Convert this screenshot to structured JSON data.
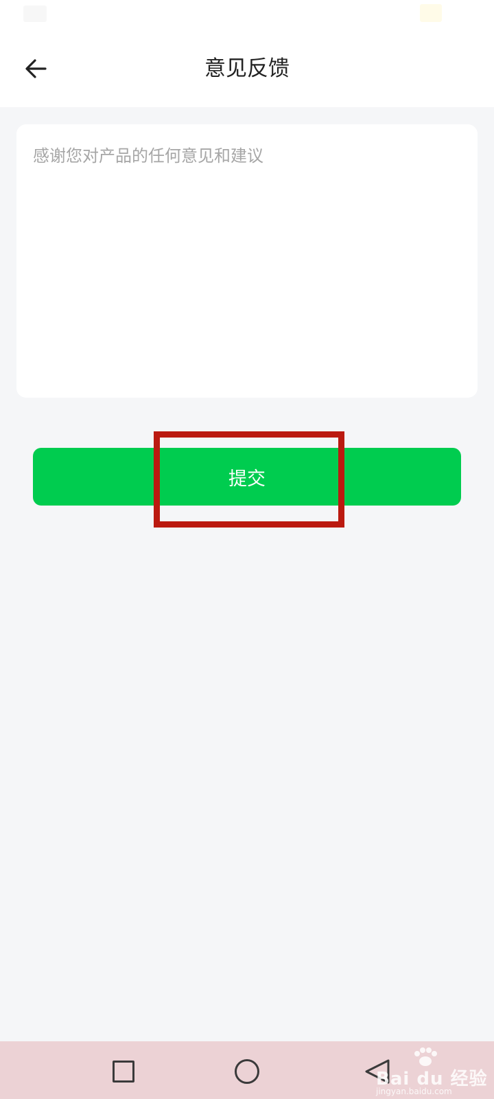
{
  "header": {
    "title": "意见反馈",
    "back_icon": "arrow-left-icon"
  },
  "feedback": {
    "placeholder": "感谢您对产品的任何意见和建议",
    "value": ""
  },
  "submit": {
    "label": "提交",
    "color": "#00cc4f"
  },
  "annotation": {
    "highlight_color": "#bb1a10"
  },
  "navigation_bar": {
    "background": "#ecd2d5",
    "recent_icon": "square-icon",
    "home_icon": "circle-icon",
    "back_icon": "triangle-back-icon"
  },
  "watermark": {
    "logo_text": "Bai  du 经验",
    "site": "jingyan.baidu.com"
  }
}
